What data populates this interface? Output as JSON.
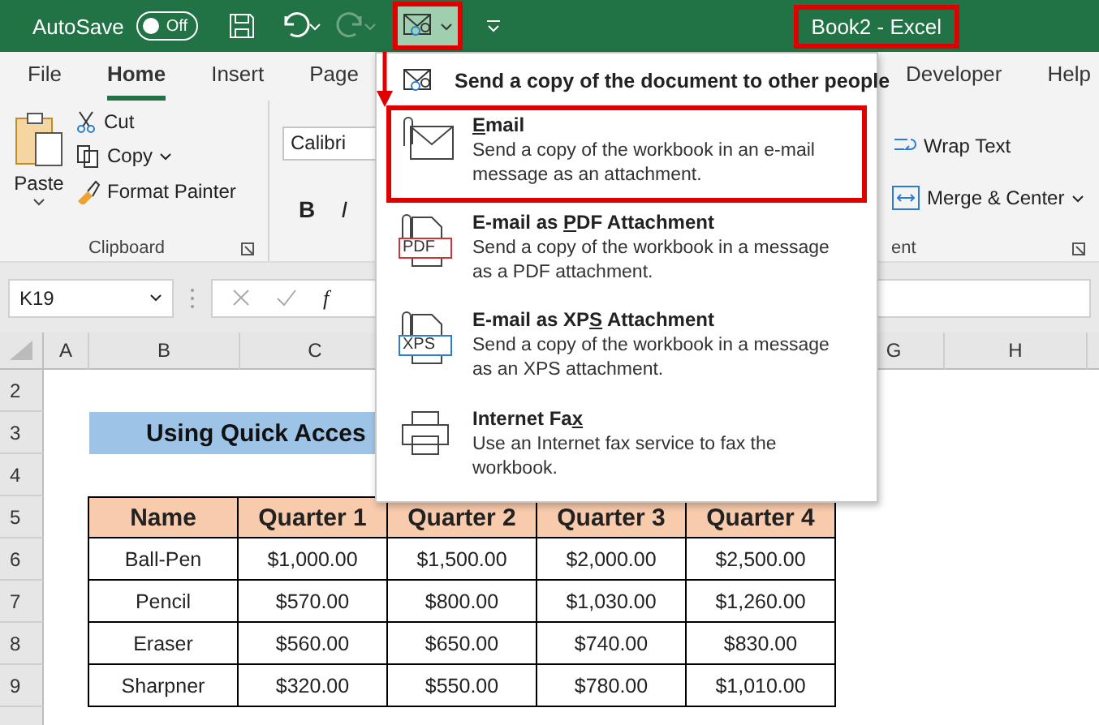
{
  "title_bar": {
    "autosave_label": "AutoSave",
    "autosave": {
      "on": false,
      "label": "Off"
    },
    "redo_disabled": true,
    "send_copy_highlighted": true,
    "title": "Book2  -  Excel",
    "title_highlighted": true
  },
  "ribbon_tabs": [
    {
      "label": "File",
      "selected": false
    },
    {
      "label": "Home",
      "selected": true
    },
    {
      "label": "Insert",
      "selected": false
    },
    {
      "label": "Page",
      "selected": false
    },
    {
      "label": "Developer",
      "selected": false
    },
    {
      "label": "Help",
      "selected": false
    }
  ],
  "clipboard": {
    "paste": "Paste",
    "cut": "Cut",
    "copy": "Copy",
    "format_painter": "Format Painter",
    "group_label": "Clipboard"
  },
  "font": {
    "name": "Calibri",
    "bold": "B",
    "italic": "I"
  },
  "alignment": {
    "wrap_text": "Wrap Text",
    "merge_center": "Merge & Center",
    "group_label": "ent"
  },
  "formula_bar": {
    "name_box": "K19",
    "fx_label": "f"
  },
  "send_menu": {
    "arrow": true,
    "header": "Send a copy of the document to other people",
    "items": [
      {
        "kind": "email",
        "title_key": "E",
        "title_after": "mail",
        "description": "Send a copy of the workbook in an e-mail message as an attachment.",
        "highlighted": true
      },
      {
        "kind": "document",
        "icon_label": "PDF",
        "color": "#d13438",
        "title_before": "E-mail as ",
        "title_key": "P",
        "title_after": "DF Attachment",
        "description": "Send a copy of the workbook in a message as a PDF attachment.",
        "highlighted": false
      },
      {
        "kind": "document",
        "icon_label": "XPS",
        "color": "#2b7cd3",
        "title_before": "E-mail as XP",
        "title_key": "S",
        "title_after": " Attachment",
        "description": "Send a copy of the workbook in a message as an XPS attachment.",
        "highlighted": false
      },
      {
        "kind": "fax",
        "title_before": "Internet Fa",
        "title_key": "x",
        "description": "Use an Internet fax service to fax the workbook.",
        "highlighted": false
      }
    ]
  },
  "sheet": {
    "column_headers": [
      "A",
      "B",
      "C",
      "G",
      "H"
    ],
    "row_numbers": [
      "2",
      "3",
      "4",
      "5",
      "6",
      "7",
      "8",
      "9"
    ],
    "title": "Using Quick Acces",
    "table": {
      "columns": [
        "Name",
        "Quarter 1",
        "Quarter 2",
        "Quarter 3",
        "Quarter 4"
      ],
      "rows": [
        [
          "Ball-Pen",
          "$1,000.00",
          "$1,500.00",
          "$2,000.00",
          "$2,500.00"
        ],
        [
          "Pencil",
          "$570.00",
          "$800.00",
          "$1,030.00",
          "$1,260.00"
        ],
        [
          "Eraser",
          "$560.00",
          "$650.00",
          "$740.00",
          "$830.00"
        ],
        [
          "Sharpner",
          "$320.00",
          "$550.00",
          "$780.00",
          "$1,010.00"
        ]
      ]
    }
  }
}
